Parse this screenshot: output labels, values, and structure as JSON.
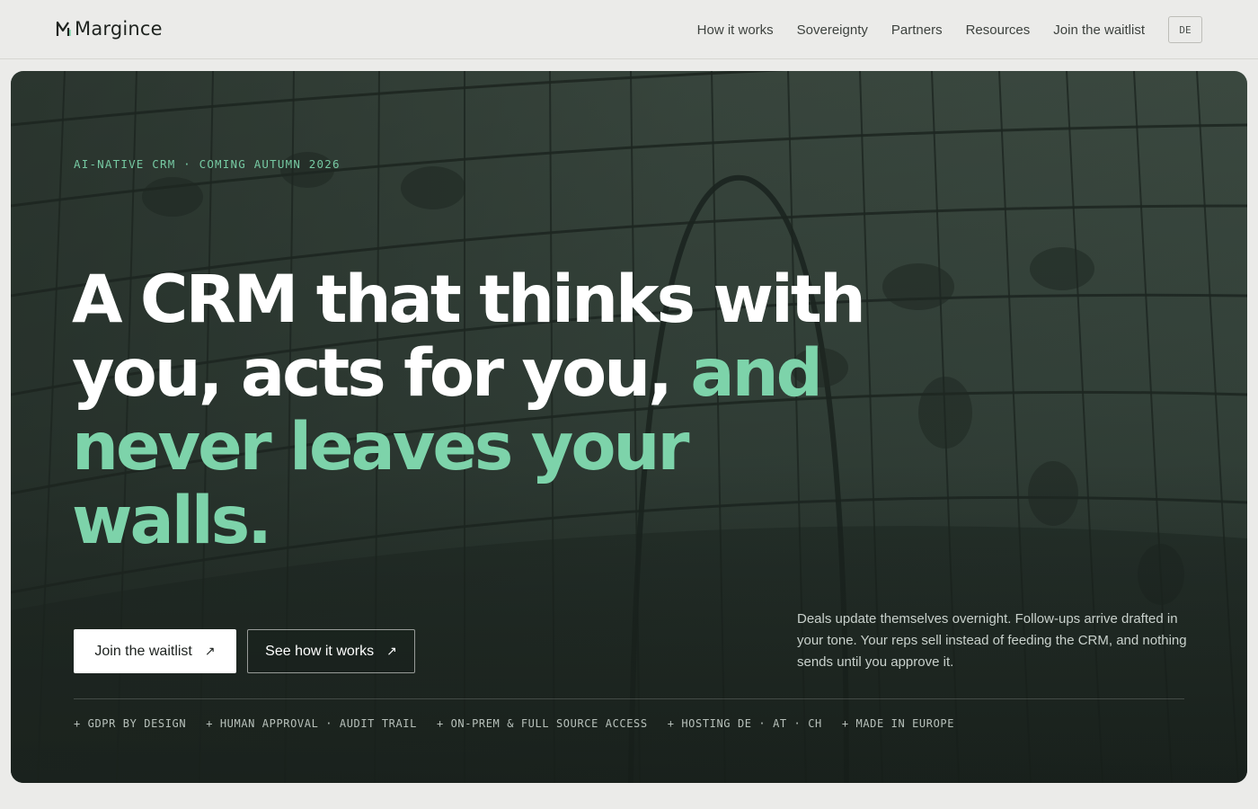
{
  "brand": {
    "name": "Margince"
  },
  "nav": {
    "links": [
      "How it works",
      "Sovereignty",
      "Partners",
      "Resources",
      "Join the waitlist"
    ],
    "lang_label": "DE"
  },
  "hero": {
    "eyebrow": "AI-NATIVE CRM · COMING AUTUMN 2026",
    "headline_line1": "A CRM that thinks with",
    "headline_line2_white": "you, acts for you,",
    "headline_line2_accent": "and",
    "headline_line3_accent": "never leaves your walls.",
    "primary_cta": "Join the waitlist",
    "secondary_cta": "See how it works",
    "cta_arrow": "↗",
    "description": "Deals update themselves overnight. Follow-ups arrive drafted in your tone. Your reps sell instead of feeding the CRM, and nothing sends until you approve it.",
    "badges": [
      "+ GDPR BY DESIGN",
      "+ HUMAN APPROVAL · AUDIT TRAIL",
      "+ ON-PREM & FULL SOURCE ACCESS",
      "+ HOSTING DE · AT · CH",
      "+ MADE IN EUROPE"
    ]
  },
  "colors": {
    "background": "#ebebe9",
    "accent": "#7dd3aa",
    "hero_dark": "#34423a"
  },
  "icons": [
    "margince-logo-icon",
    "arrow-up-right-icon"
  ]
}
